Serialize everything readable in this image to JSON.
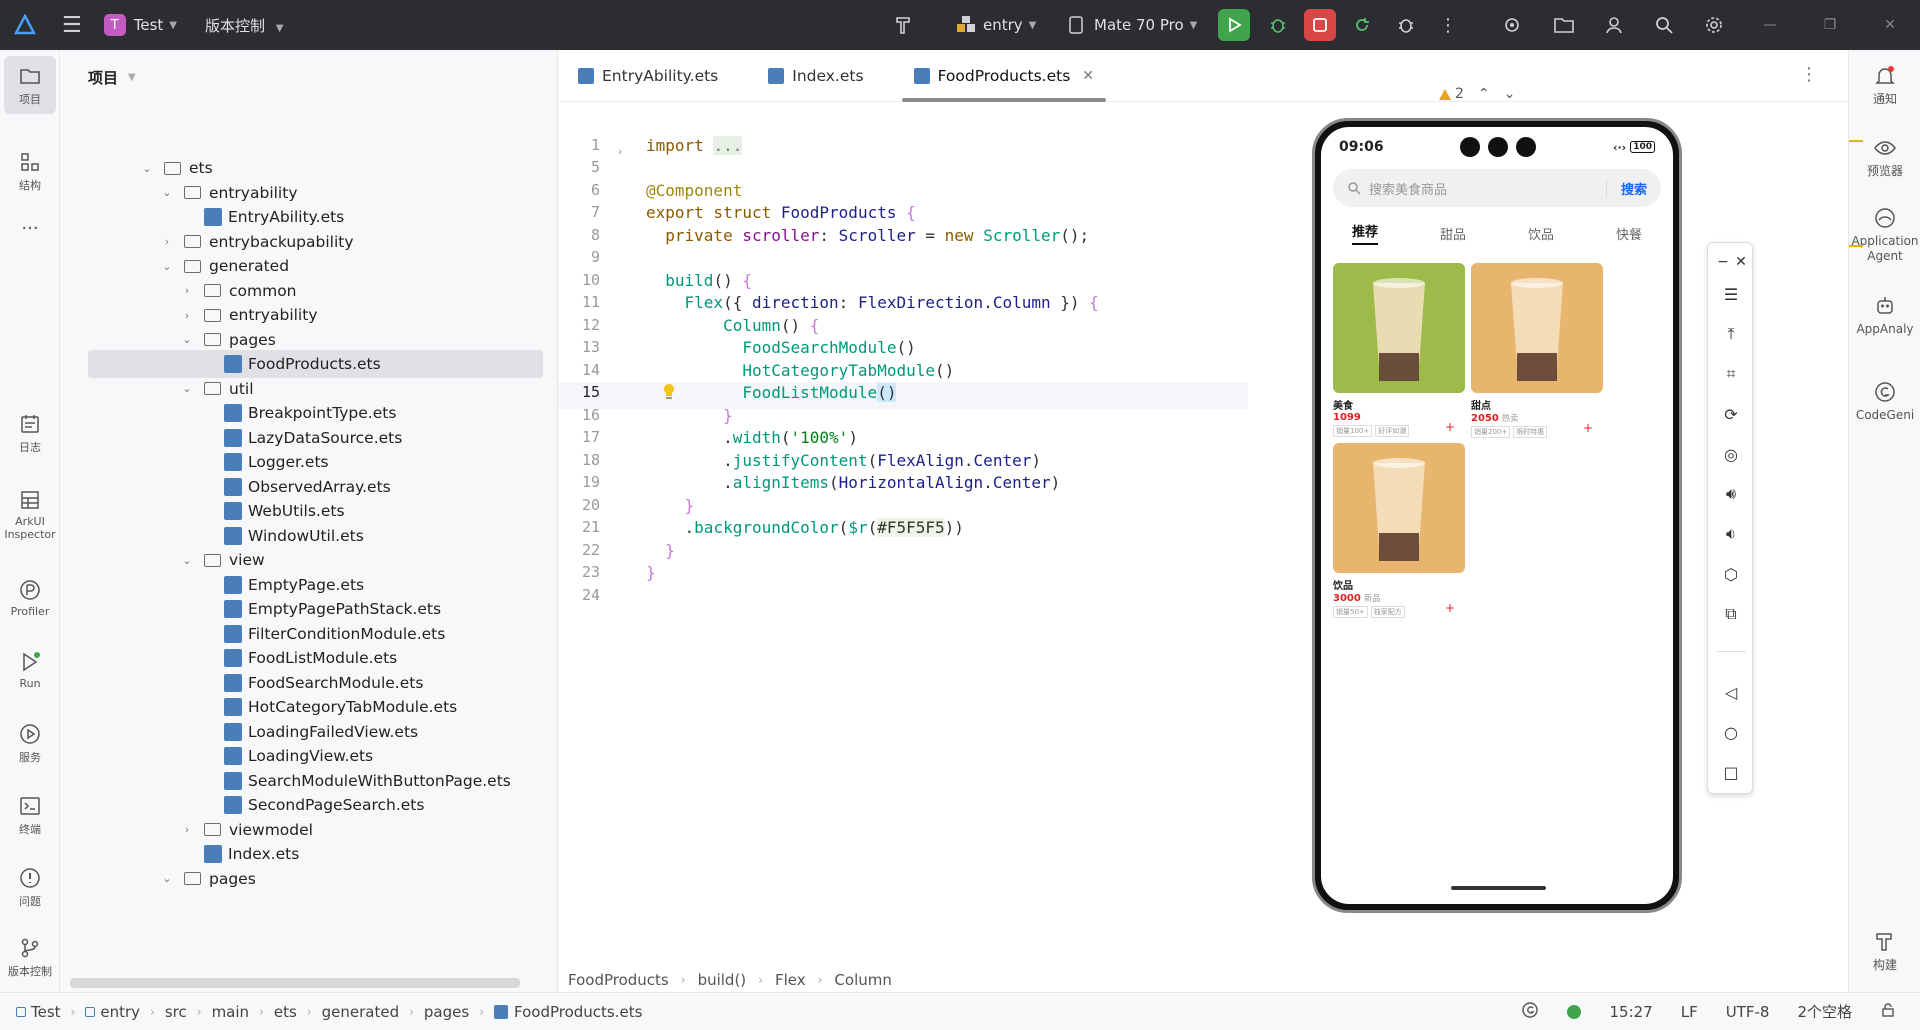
{
  "titlebar": {
    "project_initial": "T",
    "project_name": "Test",
    "vc_label": "版本控制",
    "module": "entry",
    "device": "Mate 70 Pro"
  },
  "leftbar": {
    "items": [
      {
        "label": "项目"
      },
      {
        "label": "结构"
      },
      {
        "label": "日志"
      },
      {
        "label": "ArkUI Inspector"
      },
      {
        "label": "Profiler"
      },
      {
        "label": "Run"
      },
      {
        "label": "服务"
      },
      {
        "label": "终端"
      },
      {
        "label": "问题"
      },
      {
        "label": "版本控制"
      }
    ]
  },
  "project": {
    "header": "项目",
    "tree": [
      {
        "label": "ets",
        "type": "folder",
        "depth": 0,
        "expanded": true
      },
      {
        "label": "entryability",
        "type": "folder",
        "depth": 1,
        "expanded": true
      },
      {
        "label": "EntryAbility.ets",
        "type": "file",
        "depth": 2
      },
      {
        "label": "entrybackupability",
        "type": "folder",
        "depth": 1,
        "expanded": false
      },
      {
        "label": "generated",
        "type": "folder",
        "depth": 1,
        "expanded": true
      },
      {
        "label": "common",
        "type": "folder",
        "depth": 2,
        "expanded": false
      },
      {
        "label": "entryability",
        "type": "folder",
        "depth": 2,
        "expanded": false
      },
      {
        "label": "pages",
        "type": "folder",
        "depth": 2,
        "expanded": true
      },
      {
        "label": "FoodProducts.ets",
        "type": "file",
        "depth": 3,
        "selected": true
      },
      {
        "label": "util",
        "type": "folder",
        "depth": 2,
        "expanded": true
      },
      {
        "label": "BreakpointType.ets",
        "type": "file",
        "depth": 3
      },
      {
        "label": "LazyDataSource.ets",
        "type": "file",
        "depth": 3
      },
      {
        "label": "Logger.ets",
        "type": "file",
        "depth": 3
      },
      {
        "label": "ObservedArray.ets",
        "type": "file",
        "depth": 3
      },
      {
        "label": "WebUtils.ets",
        "type": "file",
        "depth": 3
      },
      {
        "label": "WindowUtil.ets",
        "type": "file",
        "depth": 3
      },
      {
        "label": "view",
        "type": "folder",
        "depth": 2,
        "expanded": true
      },
      {
        "label": "EmptyPage.ets",
        "type": "file",
        "depth": 3
      },
      {
        "label": "EmptyPagePathStack.ets",
        "type": "file",
        "depth": 3
      },
      {
        "label": "FilterConditionModule.ets",
        "type": "file",
        "depth": 3
      },
      {
        "label": "FoodListModule.ets",
        "type": "file",
        "depth": 3
      },
      {
        "label": "FoodSearchModule.ets",
        "type": "file",
        "depth": 3
      },
      {
        "label": "HotCategoryTabModule.ets",
        "type": "file",
        "depth": 3
      },
      {
        "label": "LoadingFailedView.ets",
        "type": "file",
        "depth": 3
      },
      {
        "label": "LoadingView.ets",
        "type": "file",
        "depth": 3
      },
      {
        "label": "SearchModuleWithButtonPage.ets",
        "type": "file",
        "depth": 3
      },
      {
        "label": "SecondPageSearch.ets",
        "type": "file",
        "depth": 3
      },
      {
        "label": "viewmodel",
        "type": "folder",
        "depth": 2,
        "expanded": false
      },
      {
        "label": "Index.ets",
        "type": "file",
        "depth": 2
      },
      {
        "label": "pages",
        "type": "folder",
        "depth": 1,
        "expanded": true
      }
    ]
  },
  "editor": {
    "tabs": [
      {
        "label": "EntryAbility.ets",
        "active": false
      },
      {
        "label": "Index.ets",
        "active": false
      },
      {
        "label": "FoodProducts.ets",
        "active": true
      }
    ],
    "line_numbers": [
      "1",
      "5",
      "6",
      "7",
      "8",
      "9",
      "10",
      "11",
      "12",
      "13",
      "14",
      "15",
      "16",
      "17",
      "18",
      "19",
      "20",
      "21",
      "22",
      "23",
      "24"
    ],
    "current_line": "15",
    "warning_count": "2",
    "breadcrumb": [
      "FoodProducts",
      "build()",
      "Flex",
      "Column"
    ]
  },
  "preview": {
    "time": "09:06",
    "battery": "100",
    "search_placeholder": "搜索美食商品",
    "search_button": "搜索",
    "tabs": [
      "推荐",
      "甜品",
      "饮品",
      "快餐"
    ],
    "cards": [
      {
        "name": "美食",
        "price": "1099",
        "extra": "",
        "tags": [
          "销量100+",
          "好评如潮"
        ],
        "color": "#9dba4a"
      },
      {
        "name": "甜点",
        "price": "2050",
        "extra": "热卖",
        "tags": [
          "销量200+",
          "限时特惠"
        ],
        "color": "#e8b56f"
      },
      {
        "name": "饮品",
        "price": "3000",
        "extra": "新品",
        "tags": [
          "销量50+",
          "独家配方"
        ],
        "color": "#e8b56f"
      }
    ]
  },
  "rightbar": {
    "items": [
      {
        "label": "通知"
      },
      {
        "label": "预览器"
      },
      {
        "label": "Application Agent"
      },
      {
        "label": "AppAnaly"
      },
      {
        "label": "CodeGeni"
      },
      {
        "label": "构建"
      }
    ]
  },
  "statusbar": {
    "path": [
      "Test",
      "entry",
      "src",
      "main",
      "ets",
      "generated",
      "pages",
      "FoodProducts.ets"
    ],
    "position": "15:27",
    "line_ending": "LF",
    "encoding": "UTF-8",
    "indent": "2个空格"
  }
}
